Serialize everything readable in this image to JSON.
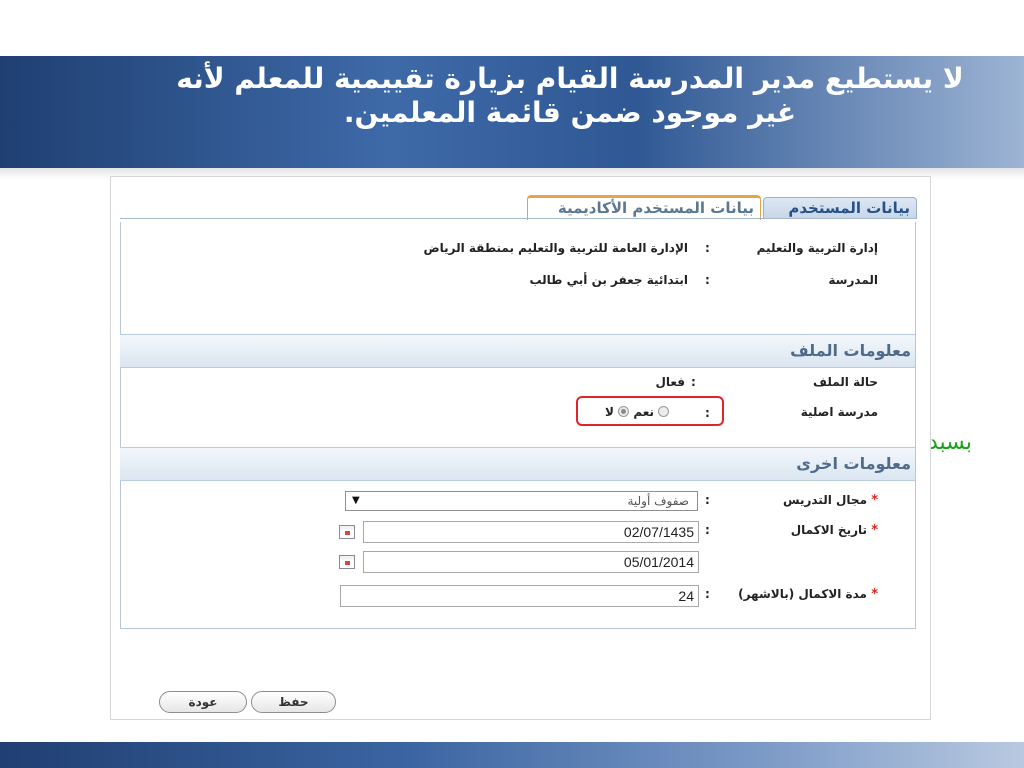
{
  "slide": {
    "title_line1": "لا يستطيع مدير المدرسة القيام بزيارة تقييمية للمعلم لأنه",
    "title_line2": "غير موجود ضمن قائمة المعلمين.",
    "side_note": "بسبد"
  },
  "tabs": [
    {
      "label": "بيانات المستخدم",
      "active": false
    },
    {
      "label": "بيانات المستخدم الأكاديمية",
      "active": true
    }
  ],
  "info": {
    "directorate_label": "إدارة التربية والتعليم",
    "directorate_value": "الإدارة العامة للتربية والتعليم بمنطقة الرياض",
    "school_label": "المدرسة",
    "school_value": "ابتدائية جعفر بن أبي طالب"
  },
  "file_section": {
    "title": "معلومات الملف",
    "status_label": "حالة الملف",
    "status_value": "فعال",
    "original_school_label": "مدرسة اصلية",
    "yes_label": "نعم",
    "no_label": "لا"
  },
  "other_section": {
    "title": "معلومات اخرى",
    "field_label": "مجال التدريس",
    "field_value": "صفوف أولية",
    "completion_date_label": "تاريخ الاكمال",
    "date_hijri": "02/07/1435",
    "date_gregorian": "05/01/2014",
    "duration_label": "مدة الاكمال (بالاشهر)",
    "duration_value": "24",
    "required_mark": "*",
    "colon": ":"
  },
  "buttons": {
    "save": "حفظ",
    "back": "عودة"
  },
  "colors": {
    "title_band": "#2f5894",
    "highlight_border": "#e0242b",
    "note_green": "#1aa31a",
    "active_tab_accent": "#e6a44c"
  }
}
